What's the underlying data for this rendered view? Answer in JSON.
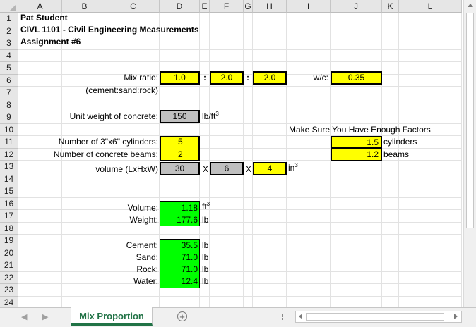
{
  "columns": [
    "A",
    "B",
    "C",
    "D",
    "E",
    "F",
    "G",
    "H",
    "I",
    "J",
    "K",
    "L"
  ],
  "rows": [
    "1",
    "2",
    "3",
    "4",
    "5",
    "6",
    "7",
    "8",
    "9",
    "10",
    "11",
    "12",
    "13",
    "14",
    "15",
    "16",
    "17",
    "18",
    "19",
    "20",
    "21",
    "22",
    "23",
    "24"
  ],
  "header": {
    "name": "Pat Student",
    "course": "CIVL 1101 - Civil Engineering Measurements",
    "assignment": "Assignment #6"
  },
  "mix": {
    "label": "Mix ratio:",
    "sub_label": "(cement:sand:rock)",
    "colon": ":",
    "cement": "1.0",
    "sand": "2.0",
    "rock": "2.0",
    "wc_label": "w/c:",
    "wc": "0.35"
  },
  "unit_weight": {
    "label": "Unit weight of concrete:",
    "value": "150",
    "unit": "lb/ft",
    "unit_exp": "3"
  },
  "factors": {
    "title": "Make Sure You Have Enough Factors",
    "cyl_value": "1.5",
    "cyl_label": "cylinders",
    "beam_value": "1.2",
    "beam_label": "beams"
  },
  "cylinders": {
    "label": "Number of 3\"x6\" cylinders:",
    "value": "5"
  },
  "beams": {
    "label": "Number of concrete beams:",
    "value": "2"
  },
  "volume_dims": {
    "label": "volume (LxHxW)",
    "l": "30",
    "x1": "X",
    "h": "6",
    "x2": "X",
    "w": "4",
    "unit": "in",
    "unit_exp": "3"
  },
  "results": {
    "volume_label": "Volume:",
    "volume": "1.18",
    "volume_unit": "ft",
    "volume_exp": "3",
    "weight_label": "Weight:",
    "weight": "177.6",
    "weight_unit": "lb"
  },
  "materials": [
    {
      "label": "Cement:",
      "value": "35.5",
      "unit": "lb"
    },
    {
      "label": "Sand:",
      "value": "71.0",
      "unit": "lb"
    },
    {
      "label": "Rock:",
      "value": "71.0",
      "unit": "lb"
    },
    {
      "label": "Water:",
      "value": "12.4",
      "unit": "lb"
    }
  ],
  "sheet_tab": "Mix Proportion",
  "icons": {
    "add_sheet": "plus-circle-icon",
    "prev": "triangle-left-icon",
    "next": "triangle-right-icon",
    "scroll_up": "triangle-up-icon"
  },
  "colors": {
    "input": "#ffff00",
    "given": "#bfbfbf",
    "output": "#00ff00",
    "tab_accent": "#217346"
  }
}
